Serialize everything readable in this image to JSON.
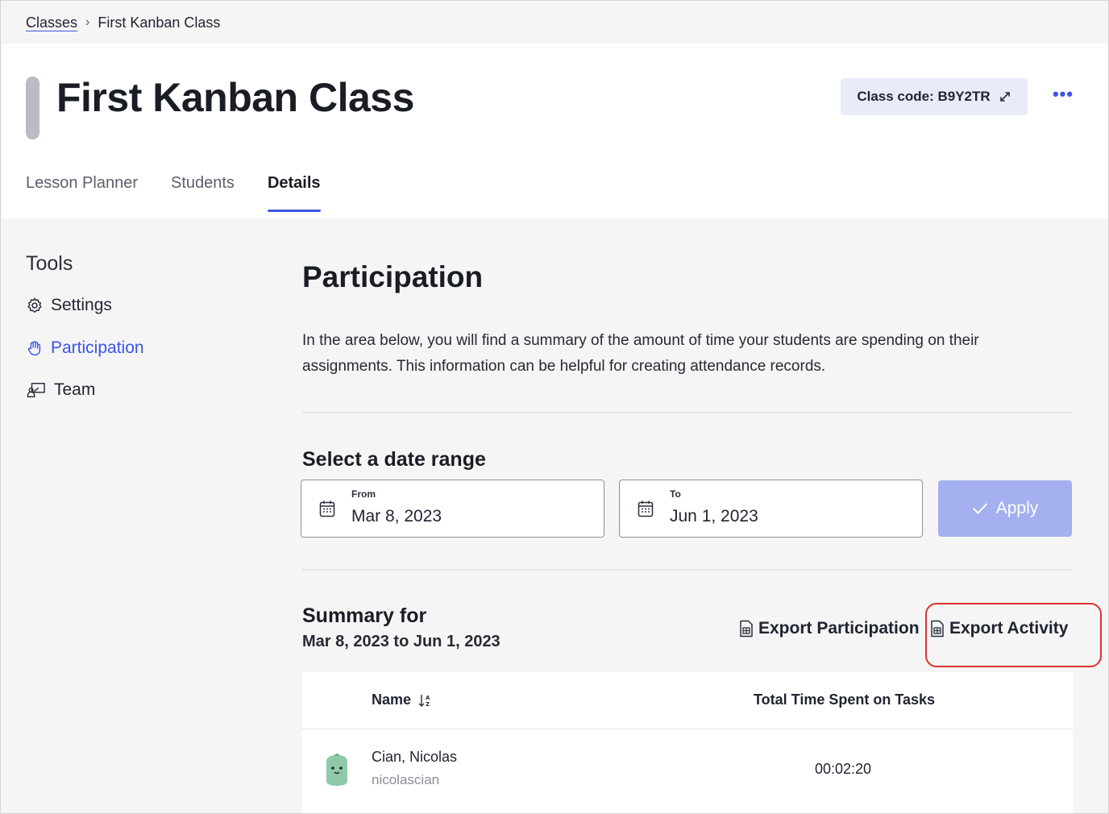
{
  "breadcrumb": {
    "parent": "Classes",
    "separator": "›",
    "current": "First Kanban Class"
  },
  "header": {
    "title": "First Kanban Class",
    "class_code_label": "Class code: B9Y2TR",
    "more_label": "•••",
    "tabs": [
      {
        "label": "Lesson Planner",
        "active": false
      },
      {
        "label": "Students",
        "active": false
      },
      {
        "label": "Details",
        "active": true
      }
    ]
  },
  "sidebar": {
    "title": "Tools",
    "items": [
      {
        "label": "Settings",
        "icon": "gear-icon",
        "active": false
      },
      {
        "label": "Participation",
        "icon": "hand-icon",
        "active": true
      },
      {
        "label": "Team",
        "icon": "team-icon",
        "active": false
      }
    ]
  },
  "main": {
    "title": "Participation",
    "description": "In the area below, you will find a summary of the amount of time your students are spending on their assignments. This information can be helpful for creating attendance records.",
    "date_range": {
      "title": "Select a date range",
      "from_label": "From",
      "from_value": "Mar 8, 2023",
      "to_label": "To",
      "to_value": "Jun 1, 2023",
      "apply_label": "Apply"
    },
    "summary": {
      "title": "Summary for",
      "range": "Mar 8, 2023 to Jun 1, 2023",
      "export_participation": "Export Participation",
      "export_activity": "Export Activity"
    },
    "table": {
      "columns": [
        "Name",
        "Total Time Spent on Tasks"
      ],
      "rows": [
        {
          "name": "Cian, Nicolas",
          "username": "nicolascian",
          "time": "00:02:20"
        }
      ]
    }
  },
  "colors": {
    "accent": "#3b55e6",
    "apply_disabled": "#a4b0f0",
    "highlight": "#d9342b",
    "avatar": "#8fc9a9"
  }
}
